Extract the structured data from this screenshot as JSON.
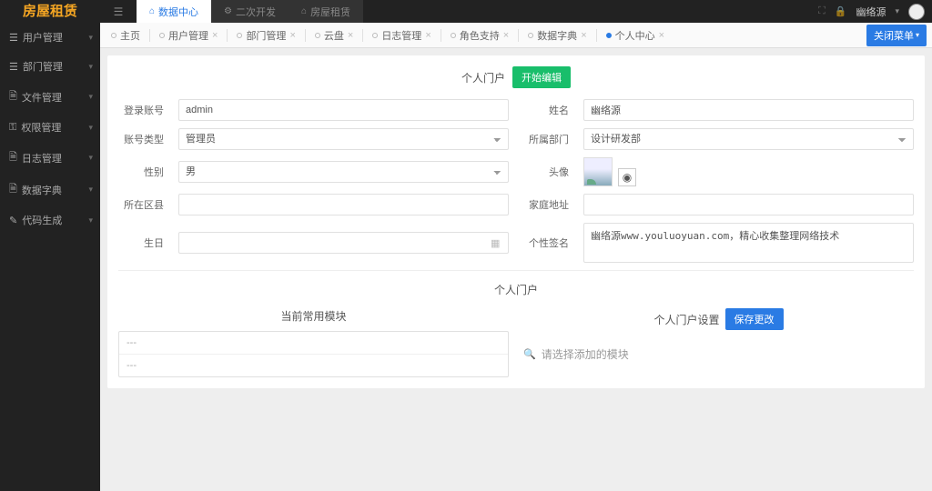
{
  "brand": "房屋租赁",
  "topTabs": [
    {
      "label": "数据中心",
      "active": true
    },
    {
      "label": "二次开发",
      "active": false
    },
    {
      "label": "房屋租赁",
      "active": false
    }
  ],
  "user": {
    "name": "幽络源"
  },
  "sidebar": [
    {
      "label": "用户管理"
    },
    {
      "label": "部门管理"
    },
    {
      "label": "文件管理"
    },
    {
      "label": "权限管理"
    },
    {
      "label": "日志管理"
    },
    {
      "label": "数据字典"
    },
    {
      "label": "代码生成"
    }
  ],
  "pageTabs": [
    {
      "label": "主页",
      "closable": false
    },
    {
      "label": "用户管理",
      "closable": true
    },
    {
      "label": "部门管理",
      "closable": true
    },
    {
      "label": "云盘",
      "closable": true
    },
    {
      "label": "日志管理",
      "closable": true
    },
    {
      "label": "角色支持",
      "closable": true
    },
    {
      "label": "数据字典",
      "closable": true
    },
    {
      "label": "个人中心",
      "closable": true,
      "active": true
    }
  ],
  "closeMenu": "关闭菜单",
  "form": {
    "title": "个人门户",
    "editBtn": "开始编辑",
    "fields": {
      "loginLabel": "登录账号",
      "loginVal": "admin",
      "nameLabel": "姓名",
      "nameVal": "幽络源",
      "acctTypeLabel": "账号类型",
      "acctTypeVal": "管理员",
      "deptLabel": "所属部门",
      "deptVal": "设计研发部",
      "genderLabel": "性别",
      "genderVal": "男",
      "avatarLabel": "头像",
      "areaLabel": "所在区县",
      "areaVal": "",
      "addrLabel": "家庭地址",
      "addrVal": "",
      "birthLabel": "生日",
      "birthVal": "",
      "sigLabel": "个性签名",
      "sigVal": "幽络源www.youluoyuan.com，精心收集整理网络技术"
    }
  },
  "portal": {
    "sectionTitle": "个人门户",
    "currentTitle": "当前常用模块",
    "rows": [
      "---",
      "---"
    ],
    "settingsTitle": "个人门户设置",
    "saveBtn": "保存更改",
    "searchPlaceholder": "请选择添加的模块"
  }
}
